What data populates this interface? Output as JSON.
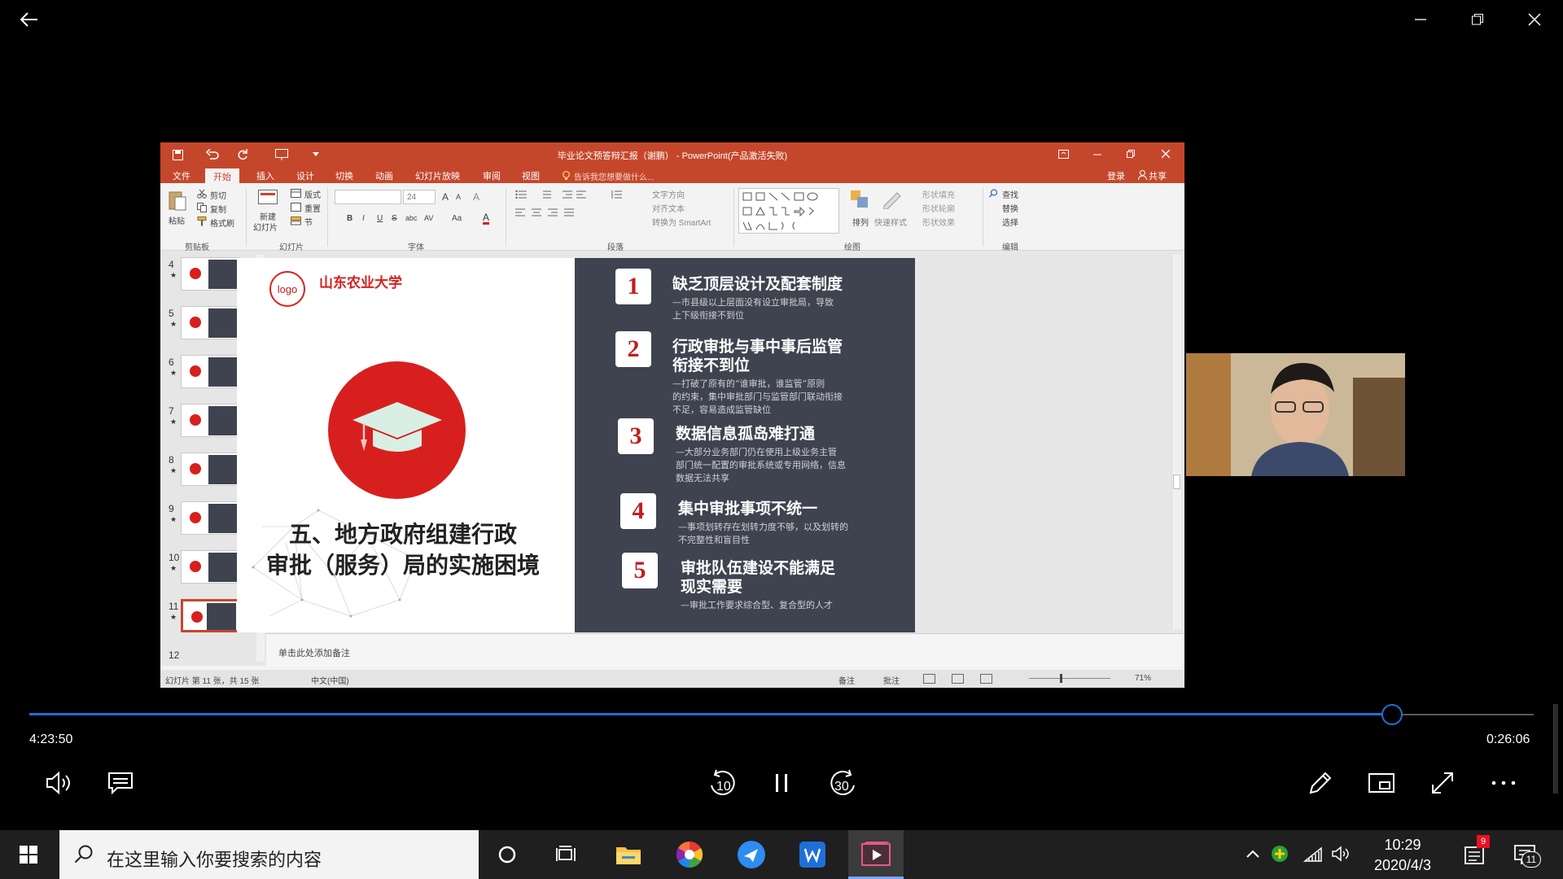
{
  "player": {
    "elapsed": "4:23:50",
    "remaining": "0:26:06",
    "progress_fraction": 0.906,
    "controls": {
      "volume": "volume-icon",
      "subtitles": "subtitles-icon",
      "rewind": "10",
      "forward": "30",
      "play_pause": "pause-icon",
      "edit": "pencil-icon",
      "miniview": "mini-view-icon",
      "fullscreen": "fullscreen-icon",
      "more": "more-icon"
    }
  },
  "ppt": {
    "window_title": "毕业论文预答辩汇报（谢鹏） - PowerPoint(产品激活失败)",
    "tabs": [
      "文件",
      "开始",
      "插入",
      "设计",
      "切换",
      "动画",
      "幻灯片放映",
      "审阅",
      "视图"
    ],
    "active_tab": "开始",
    "tell_me": "告诉我您想要做什么...",
    "login": "登录",
    "share": "共享",
    "ribbon": {
      "clipboard": {
        "paste": "粘贴",
        "cut": "剪切",
        "copy": "复制",
        "format_painter": "格式刷",
        "label": "剪贴板"
      },
      "slides": {
        "new_slide": "新建",
        "new_slide2": "幻灯片",
        "layout": "版式",
        "reset": "重置",
        "section": "节",
        "label": "幻灯片"
      },
      "font": {
        "size": "24",
        "label": "字体",
        "bold": "B",
        "italic": "I",
        "underline": "U",
        "strike": "S",
        "shadow": "abc"
      },
      "paragraph": {
        "text_dir": "文字方向",
        "align_text": "对齐文本",
        "smartart": "转换为 SmartArt",
        "label": "段落"
      },
      "drawing": {
        "arrange": "排列",
        "quick_styles": "快速样式",
        "fill": "形状填充",
        "outline": "形状轮廓",
        "effects": "形状效果",
        "label": "绘图"
      },
      "editing": {
        "find": "查找",
        "replace": "替换",
        "select": "选择",
        "label": "编辑"
      }
    },
    "thumbnails": [
      "4",
      "5",
      "6",
      "7",
      "8",
      "9",
      "10",
      "11",
      "12"
    ],
    "selected_slide": "11",
    "slide": {
      "logo": "logo",
      "university": "山东农业大学",
      "title_line1": "五、地方政府组建行政",
      "title_line2": "审批（服务）局的实施困境",
      "items": [
        {
          "num": "1",
          "heading": "缺乏顶层设计及配套制度",
          "desc": [
            "—市县级以上层面没有设立审批局，导致",
            "上下级衔接不到位"
          ]
        },
        {
          "num": "2",
          "heading": "行政审批与事中事后监管",
          "heading2": "衔接不到位",
          "desc": [
            "—打破了原有的“谁审批，谁监管”原则",
            "的约束，集中审批部门与监管部门联动衔接",
            "不足，容易造成监管缺位"
          ]
        },
        {
          "num": "3",
          "heading": "数据信息孤岛难打通",
          "desc": [
            "—大部分业务部门仍在使用上级业务主管",
            "部门统一配置的审批系统或专用网络，信息",
            "数据无法共享"
          ]
        },
        {
          "num": "4",
          "heading": "集中审批事项不统一",
          "desc": [
            "—事项划转存在划转力度不够，以及划转的",
            "不完整性和盲目性"
          ]
        },
        {
          "num": "5",
          "heading": "审批队伍建设不能满足",
          "heading2": "现实需要",
          "desc": [
            "—审批工作要求综合型、复合型的人才"
          ]
        }
      ]
    },
    "notes_placeholder": "单击此处添加备注",
    "status": {
      "slide_info": "幻灯片 第 11 张，共 15 张",
      "language": "中文(中国)",
      "notes": "备注",
      "comments": "批注",
      "zoom": "71%"
    }
  },
  "taskbar": {
    "search_placeholder": "在这里输入你要搜索的内容",
    "time": "10:29",
    "date": "2020/4/3",
    "notification_badge": "9",
    "action_center_count": "11"
  },
  "colors": {
    "ppt_accent": "#c5472b",
    "slide_dark_panel": "#3f4350",
    "slide_red": "#d7201e",
    "progress_blue": "#1e6fd8"
  }
}
